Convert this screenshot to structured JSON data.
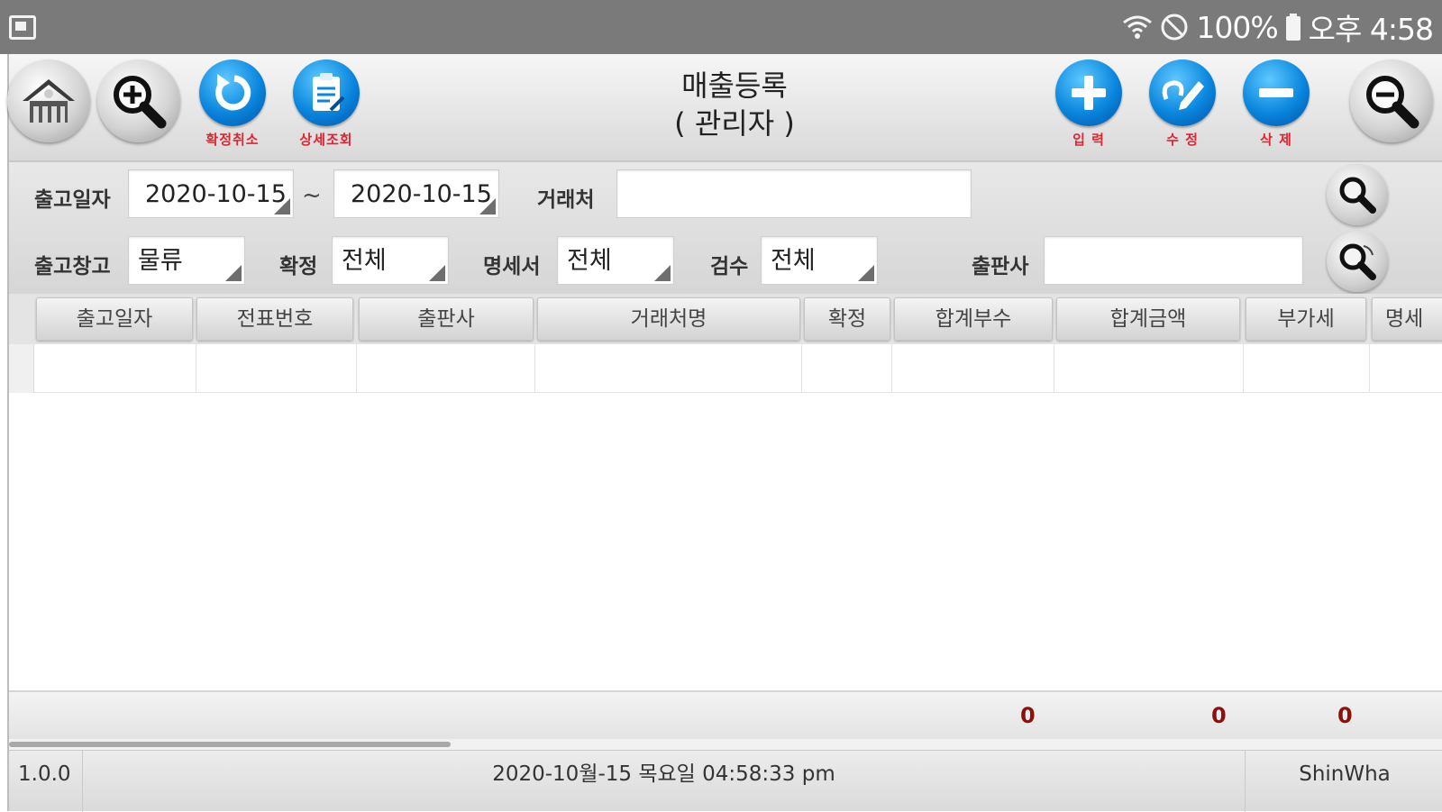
{
  "status_bar": {
    "battery_text": "100%",
    "time": "오후 4:58"
  },
  "toolbar": {
    "title_line1": "매출등록",
    "title_line2": "( 관리자 )",
    "btn_cancel_confirm": "확정취소",
    "btn_detail": "상세조회",
    "btn_input": "입 력",
    "btn_edit": "수 정",
    "btn_delete": "삭 제"
  },
  "filters": {
    "ship_date_label": "출고일자",
    "date_from": "2020-10-15",
    "date_sep": "~",
    "date_to": "2020-10-15",
    "client_label": "거래처",
    "client_value": "",
    "warehouse_label": "출고창고",
    "warehouse_value": "물류",
    "confirm_label": "확정",
    "confirm_value": "전체",
    "statement_label": "명세서",
    "statement_value": "전체",
    "inspection_label": "검수",
    "inspection_value": "전체",
    "publisher_label": "출판사",
    "publisher_value": ""
  },
  "grid": {
    "columns": [
      "출고일자",
      "전표번호",
      "출판사",
      "거래처명",
      "확정",
      "합계부수",
      "합계금액",
      "부가세",
      "명세"
    ]
  },
  "totals": {
    "total_qty": "0",
    "total_amount": "0",
    "total_vat": "0"
  },
  "footer": {
    "version": "1.0.0",
    "datetime": "2020-10월-15 목요일 04:58:33 pm",
    "company": "ShinWha"
  }
}
